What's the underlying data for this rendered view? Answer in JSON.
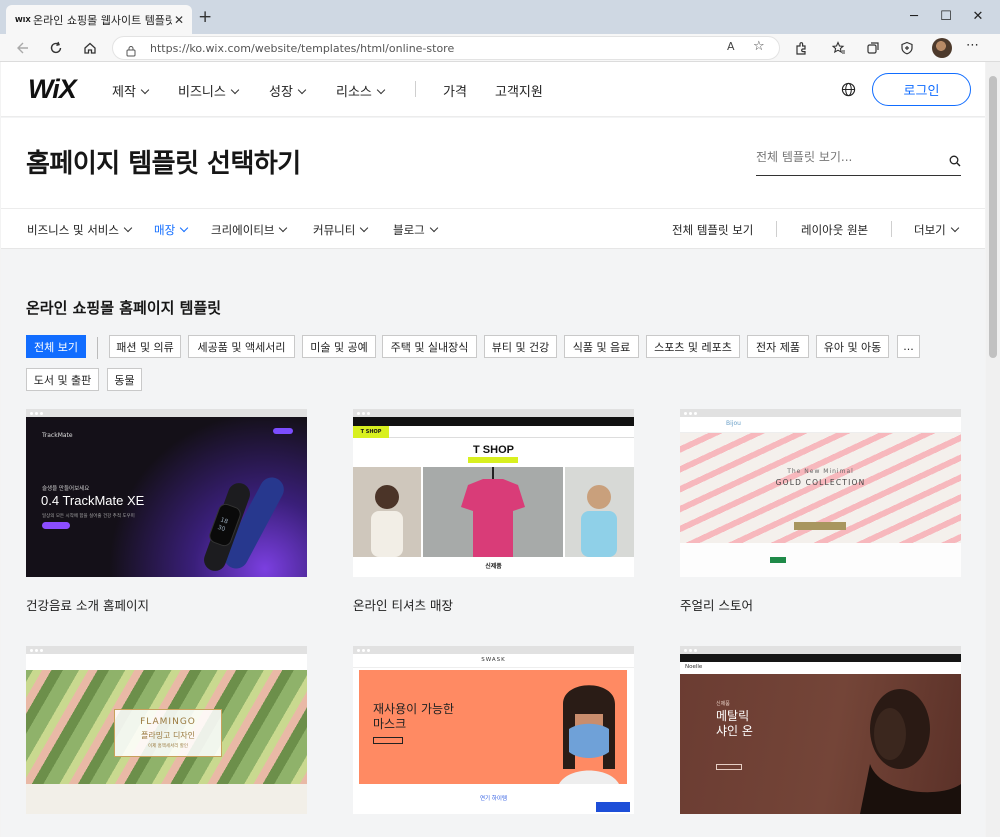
{
  "browser": {
    "favicon_text": "WIX",
    "tab_title": "온라인 쇼핑몰 웹사이트 템플릿 | Wix",
    "url": "https://ko.wix.com/website/templates/html/online-store",
    "read_aloud": "A",
    "profile_icon": "avatar"
  },
  "header": {
    "logo": "WiX",
    "nav": [
      "제작",
      "비즈니스",
      "성장",
      "리소스"
    ],
    "links": [
      "가격",
      "고객지원"
    ],
    "login": "로그인"
  },
  "hero": {
    "title": "홈페이지 템플릿 선택하기",
    "search_placeholder": "전체 템플릿 보기..."
  },
  "category_nav": {
    "items": [
      "비즈니스 및 서비스",
      "매장",
      "크리에이티브",
      "커뮤니티",
      "블로그"
    ],
    "active": "매장",
    "right": [
      "전체 템플릿 보기",
      "레이아웃 원본",
      "더보기"
    ]
  },
  "section": {
    "title": "온라인 쇼핑몰 홈페이지 템플릿",
    "chips": [
      "전체 보기",
      "패션 및 의류",
      "세공품 및 액세서리",
      "미술 및 공예",
      "주택 및 실내장식",
      "뷰티 및 건강",
      "식품 및 음료",
      "스포츠 및 레포츠",
      "전자 제품",
      "유아 및 아동",
      "...",
      "도서 및 출판",
      "동물"
    ],
    "active_chip": "전체 보기"
  },
  "templates": [
    {
      "label": "건강음료 소개 홈페이지",
      "thumb": {
        "brand": "TrackMate",
        "kicker": "슬생을 만들어보세요",
        "headline": "0.4 TrackMate XE",
        "sub": "일상의 모든 시작에 함을 실어줄 건강 추적 도우미",
        "screen_digits": "18\n30\n50"
      }
    },
    {
      "label": "온라인 티셔츠 매장",
      "thumb": {
        "tag": "T SHOP",
        "title": "T SHOP",
        "subtitle": "오늘을 위한 단 하나의 티셔츠",
        "footer": "신제품"
      }
    },
    {
      "label": "주얼리 스토어",
      "thumb": {
        "brand": "Bijou",
        "kicker": "The New Minimal",
        "title": "GOLD COLLECTION"
      }
    },
    {
      "label": "",
      "thumb": {
        "title": "FLAMINGO",
        "subtitle": "플라밍고 디자인",
        "small": "이제 홈액세서리 할인"
      }
    },
    {
      "label": "",
      "thumb": {
        "brand": "SWASK",
        "title_line1": "재사용이 가능한",
        "title_line2": "마스크",
        "footer": "연기 하이템"
      }
    },
    {
      "label": "",
      "thumb": {
        "brand": "Noelle",
        "kicker": "신제품",
        "title_line1": "메탈릭",
        "title_line2": "샤인 온"
      }
    }
  ],
  "colors": {
    "wix_blue": "#116dff",
    "page_bg": "#f3f4f5",
    "lime": "#d8f01f"
  }
}
